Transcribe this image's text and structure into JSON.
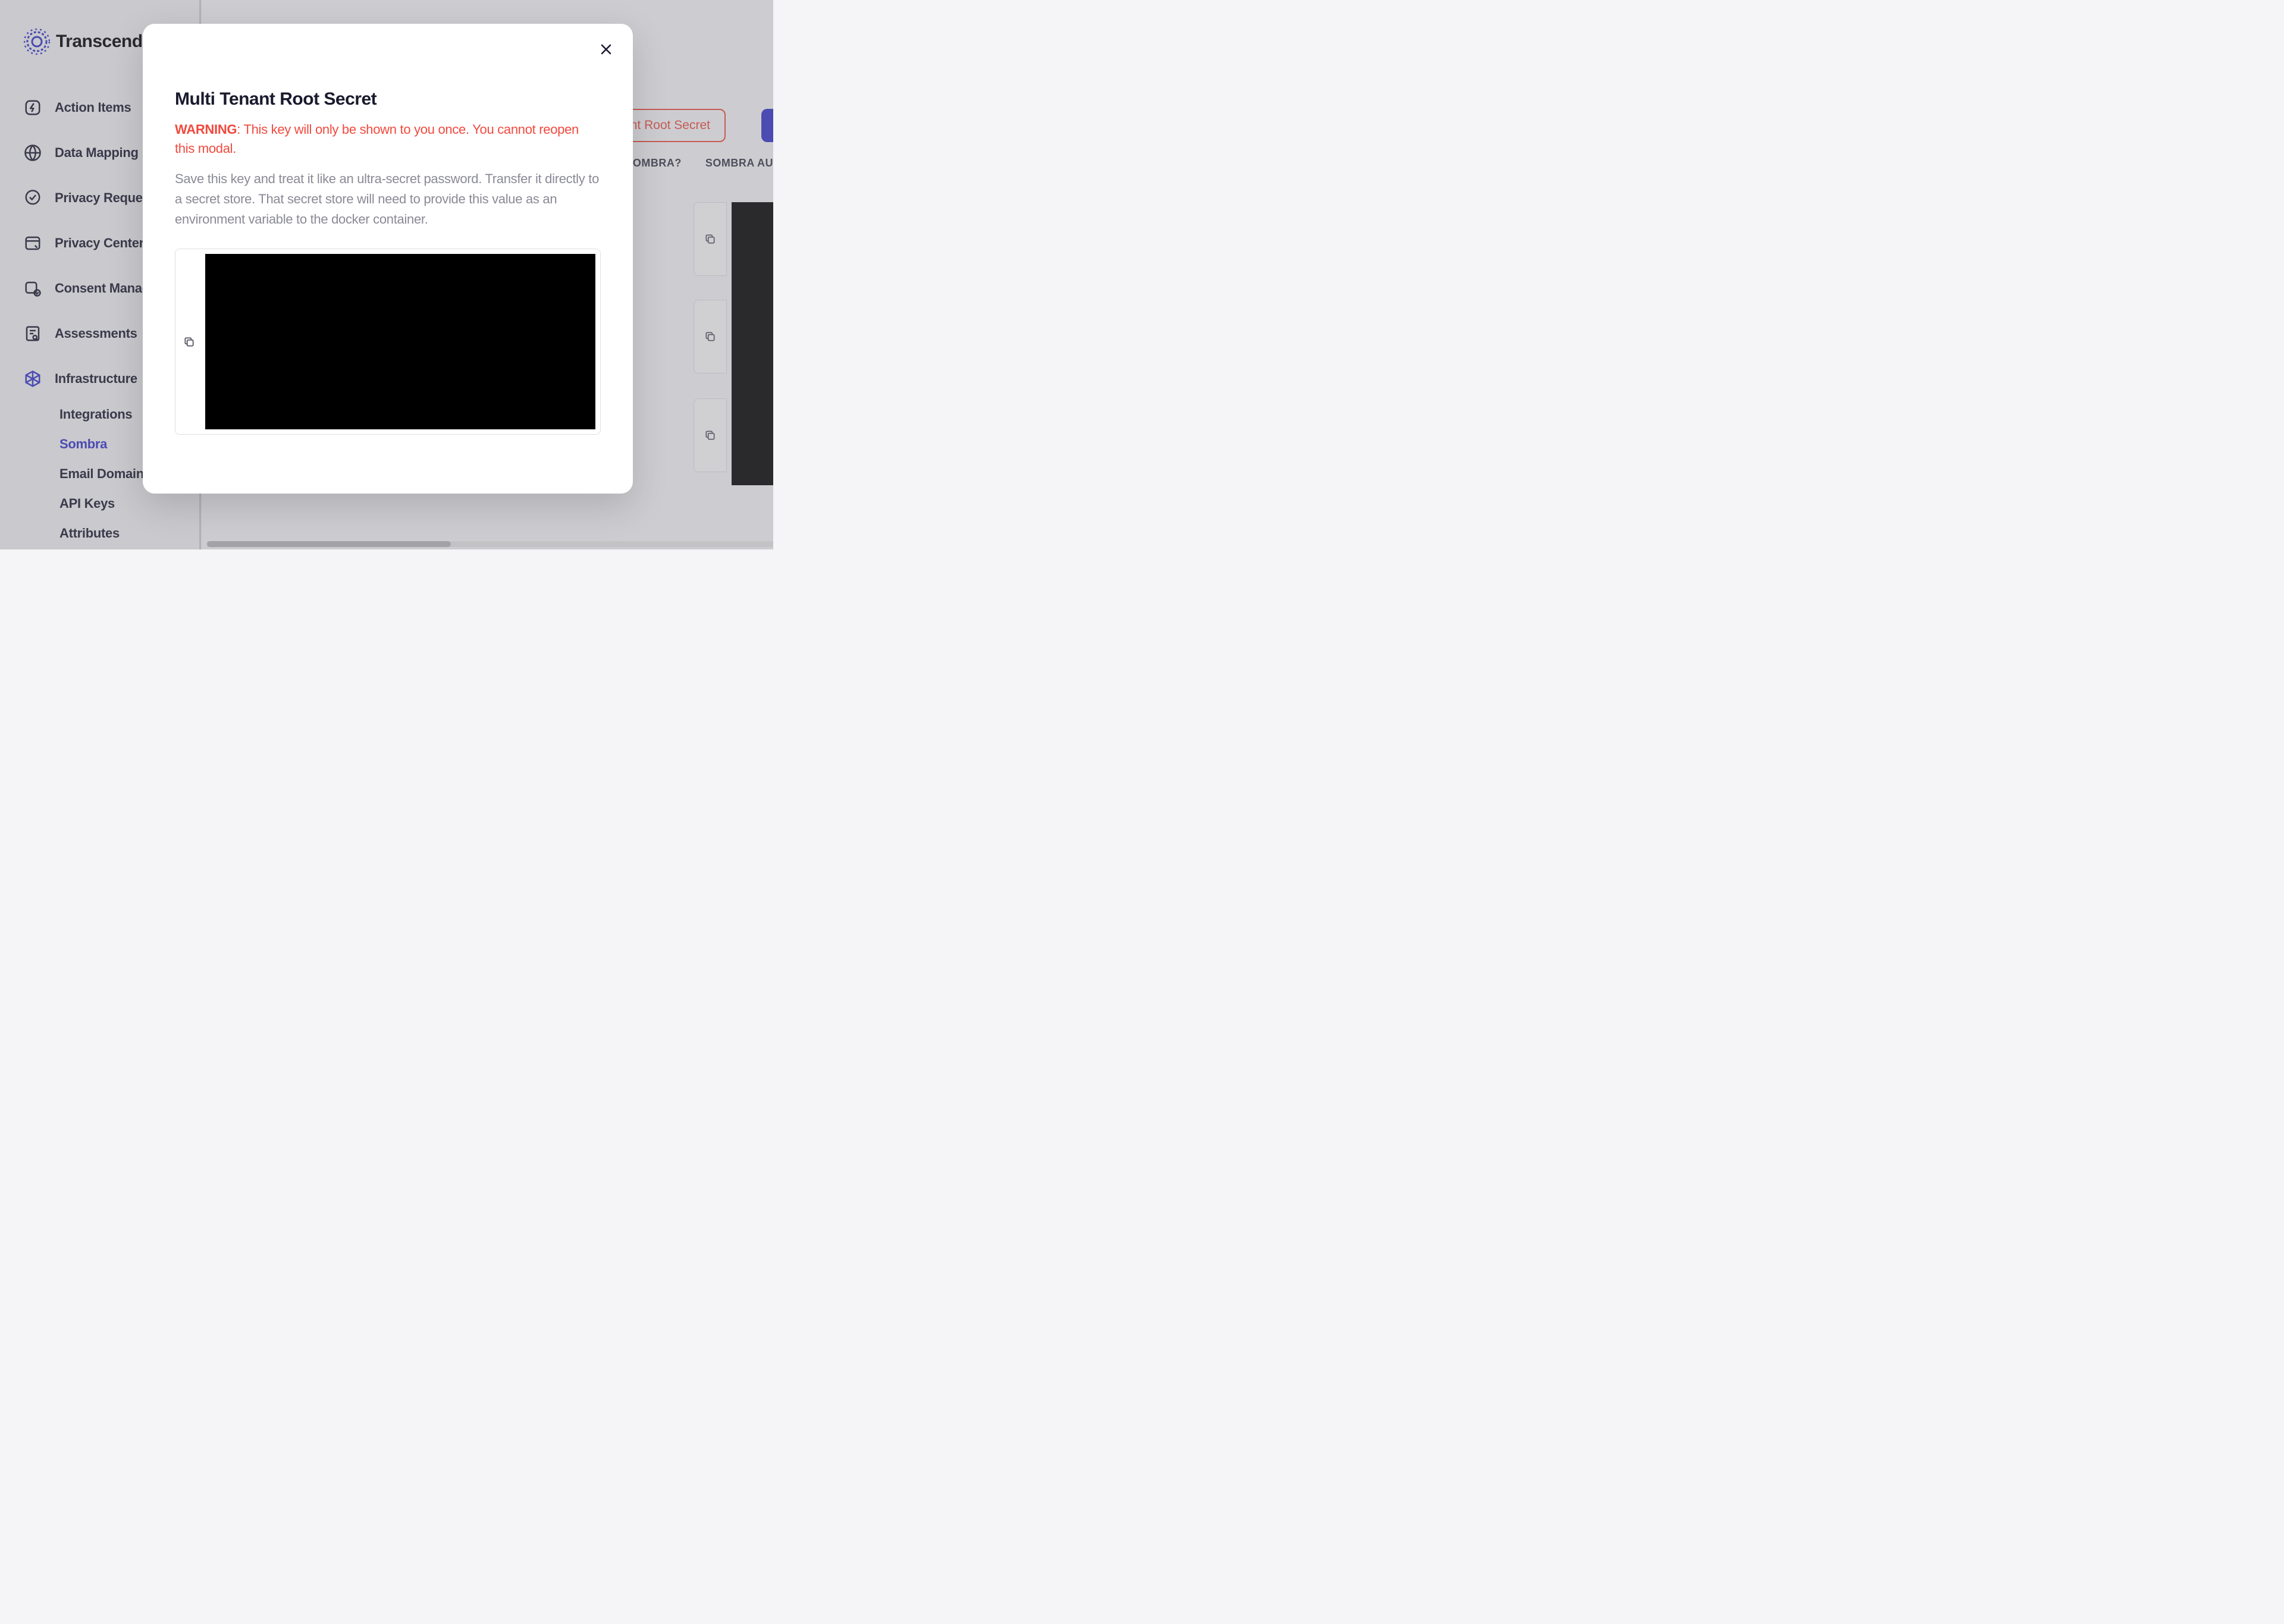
{
  "brand": {
    "name": "Transcend"
  },
  "sidebar": {
    "items": [
      {
        "label": "Action Items"
      },
      {
        "label": "Data Mapping"
      },
      {
        "label": "Privacy Requests"
      },
      {
        "label": "Privacy Center"
      },
      {
        "label": "Consent Management"
      },
      {
        "label": "Assessments"
      },
      {
        "label": "Infrastructure"
      }
    ],
    "sub_items": [
      {
        "label": "Integrations"
      },
      {
        "label": "Sombra"
      },
      {
        "label": "Email Domains"
      },
      {
        "label": "API Keys"
      },
      {
        "label": "Attributes"
      }
    ]
  },
  "main": {
    "button_outline": "Tenant Root Secret",
    "table_headers": {
      "col1": "SOMBRA?",
      "col2": "SOMBRA AU"
    }
  },
  "modal": {
    "title": "Multi Tenant Root Secret",
    "warning_label": "WARNING",
    "warning_text": ": This key will only be shown to you once. You cannot reopen this modal.",
    "description": "Save this key and treat it like an ultra-secret password. Transfer it directly to a secret store. That secret store will need to provide this value as an environment variable to the docker container."
  }
}
